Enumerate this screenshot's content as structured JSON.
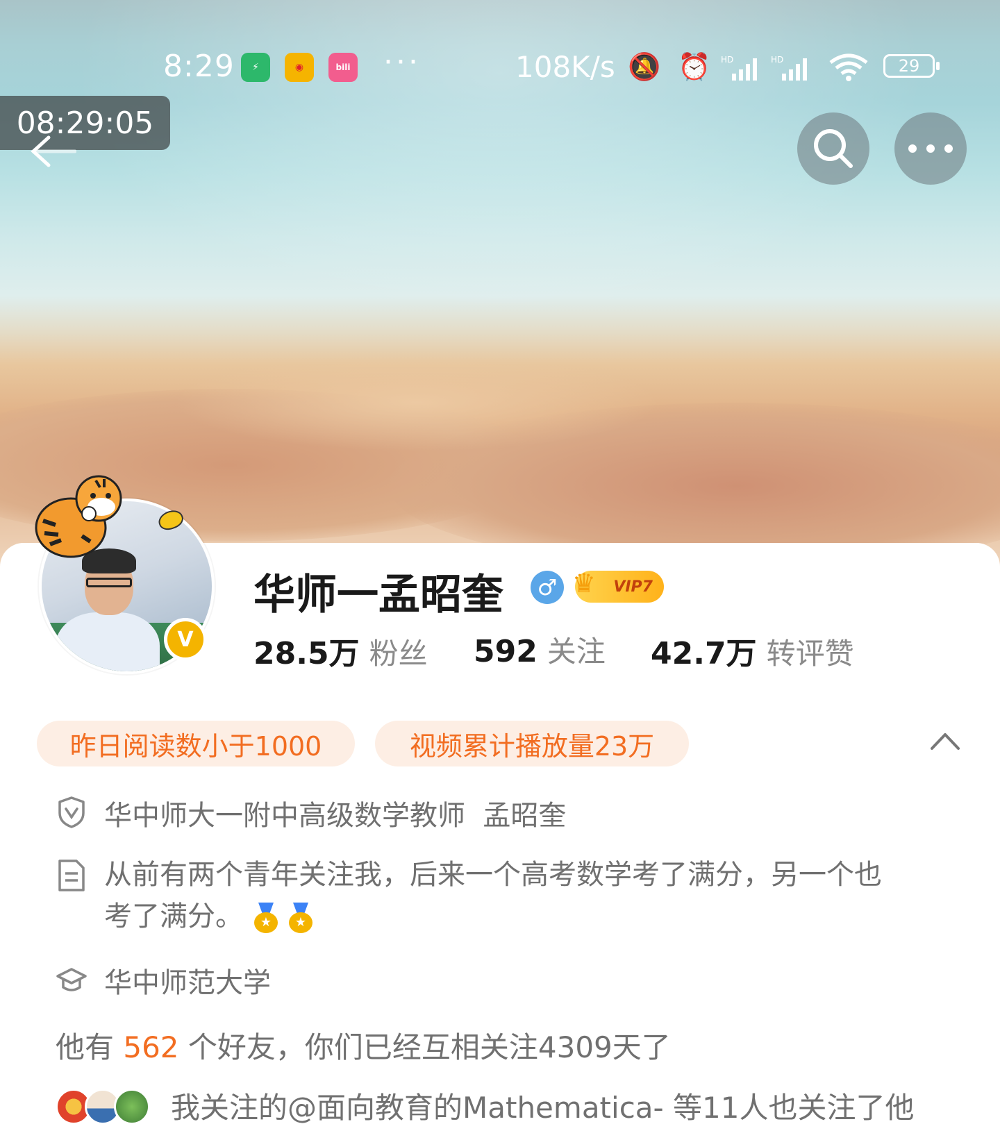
{
  "status_bar": {
    "time": "8:29",
    "net_speed": "108K/s",
    "battery": "29",
    "more": "···",
    "apps": [
      {
        "name": "security",
        "label": "⚡",
        "color": "#2db86b"
      },
      {
        "name": "weibo",
        "label": "微",
        "color": "#f5b400"
      },
      {
        "name": "bilibili",
        "label": "bili",
        "color": "#f25d8e"
      }
    ]
  },
  "overlay": {
    "timestamp": "08:29:05"
  },
  "profile": {
    "name": "华师一孟昭奎",
    "gender_symbol": "♂",
    "vip_label": "VIP7",
    "verified_symbol": "V",
    "stats": [
      {
        "value": "28.5万",
        "label": "粉丝"
      },
      {
        "value": "592",
        "label": "关注"
      },
      {
        "value": "42.7万",
        "label": "转评赞"
      }
    ]
  },
  "chips": [
    "昨日阅读数小于1000",
    "视频累计播放量23万"
  ],
  "info": {
    "verification": "华中师大一附中高级数学教师  孟昭奎",
    "bio": "从前有两个青年关注我，后来一个高考数学考了满分，另一个也考了满分。",
    "school": "华中师范大学"
  },
  "friends": {
    "prefix": "他有 ",
    "count": "562",
    "suffix": " 个好友，你们已经互相关注4309天了"
  },
  "mutual": {
    "text": "我关注的@面向教育的Mathematica- 等11人也关注了他"
  },
  "colors": {
    "accent": "#f26d21",
    "chip_bg": "#fdeee4",
    "verified": "#f4b400",
    "gender": "#5aa6e8"
  }
}
